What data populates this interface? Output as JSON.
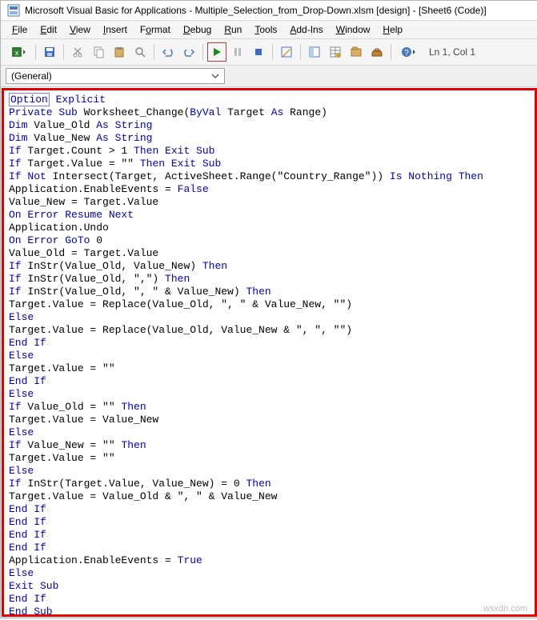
{
  "title": "Microsoft Visual Basic for Applications - Multiple_Selection_from_Drop-Down.xlsm [design] - [Sheet6 (Code)]",
  "menu": {
    "file": "File",
    "edit": "Edit",
    "view": "View",
    "insert": "Insert",
    "format": "Format",
    "debug": "Debug",
    "run": "Run",
    "tools": "Tools",
    "addins": "Add-Ins",
    "window": "Window",
    "help": "Help"
  },
  "toolbar": {
    "location": "Ln 1, Col 1"
  },
  "object_dd": "(General)",
  "watermark": "wsxdn.com",
  "code": {
    "l1a": "Option",
    "l1b": " Explicit",
    "l2a": "Private Sub",
    "l2b": " Worksheet_Change(",
    "l2c": "ByVal",
    "l2d": " Target ",
    "l2e": "As",
    "l2f": " Range)",
    "l3a": "Dim",
    "l3b": " Value_Old ",
    "l3c": "As String",
    "l4a": "Dim",
    "l4b": " Value_New ",
    "l4c": "As String",
    "l5a": "If",
    "l5b": " Target.Count > 1 ",
    "l5c": "Then Exit Sub",
    "l6a": "If",
    "l6b": " Target.Value = \"\" ",
    "l6c": "Then Exit Sub",
    "l7a": "If Not",
    "l7b": " Intersect(Target, ActiveSheet.Range(\"Country_Range\")) ",
    "l7c": "Is Nothing Then",
    "l8": "Application.EnableEvents = ",
    "l8b": "False",
    "l9": "Value_New = Target.Value",
    "l10": "On Error Resume Next",
    "l11": "Application.Undo",
    "l12": "On Error GoTo",
    "l12b": " 0",
    "l13": "Value_Old = Target.Value",
    "l14a": "If",
    "l14b": " InStr(Value_Old, Value_New) ",
    "l14c": "Then",
    "l15a": "If",
    "l15b": " InStr(Value_Old, \",\") ",
    "l15c": "Then",
    "l16a": "If",
    "l16b": " InStr(Value_Old, \", \" & Value_New) ",
    "l16c": "Then",
    "l17": "Target.Value = Replace(Value_Old, \", \" & Value_New, \"\")",
    "l18": "Else",
    "l19": "Target.Value = Replace(Value_Old, Value_New & \", \", \"\")",
    "l20": "End If",
    "l21": "Else",
    "l22": "Target.Value = \"\"",
    "l23": "End If",
    "l24": "Else",
    "l25a": "If",
    "l25b": " Value_Old = \"\" ",
    "l25c": "Then",
    "l26": "Target.Value = Value_New",
    "l27": "Else",
    "l28a": "If",
    "l28b": " Value_New = \"\" ",
    "l28c": "Then",
    "l29": "Target.Value = \"\"",
    "l30": "Else",
    "l31a": "If",
    "l31b": " InStr(Target.Value, Value_New) = 0 ",
    "l31c": "Then",
    "l32": "Target.Value = Value_Old & \", \" & Value_New",
    "l33": "End If",
    "l34": "End If",
    "l35": "End If",
    "l36": "End If",
    "l37": "Application.EnableEvents = ",
    "l37b": "True",
    "l38": "Else",
    "l39": "Exit Sub",
    "l40": "End If",
    "l41": "End Sub"
  }
}
